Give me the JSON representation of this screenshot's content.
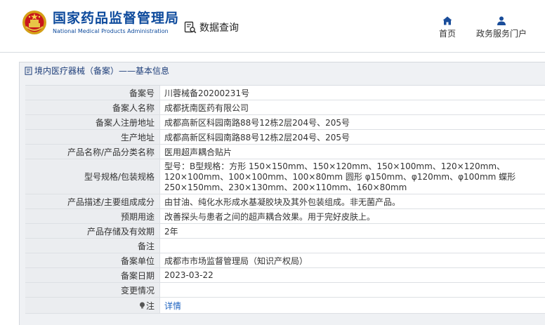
{
  "header": {
    "logo_cn": "国家药品监督管理局",
    "logo_en": "National Medical Products Administration",
    "data_query": "数据查询",
    "nav": [
      {
        "label": "首页",
        "icon": "home-icon"
      },
      {
        "label": "政务服务门户",
        "icon": "user-icon"
      }
    ]
  },
  "panel": {
    "title": "境内医疗器械（备案）——基本信息"
  },
  "rows": [
    {
      "label": "备案号",
      "value": "川蓉械备20200231号"
    },
    {
      "label": "备案人名称",
      "value": "成都抚南医药有限公司"
    },
    {
      "label": "备案人注册地址",
      "value": "成都高新区科园南路88号12栋2层204号、205号"
    },
    {
      "label": "生产地址",
      "value": "成都高新区科园南路88号12栋2层204号、205号"
    },
    {
      "label": "产品名称/产品分类名称",
      "value": "医用超声耦合贴片"
    },
    {
      "label": "型号规格/包装规格",
      "value": "型号：B型规格：方形 150×150mm、150×120mm、150×100mm、120×120mm、120×100mm、100×100mm、100×80mm 圆形 φ150mm、φ120mm、φ100mm 蝶形 250×150mm、230×130mm、200×110mm、160×80mm"
    },
    {
      "label": "产品描述/主要组成成分",
      "value": "由甘油、纯化水形成水基凝胶块及其外包装组成。非无菌产品。"
    },
    {
      "label": "预期用途",
      "value": "改善探头与患者之间的超声耦合效果。用于完好皮肤上。"
    },
    {
      "label": "产品存储及有效期",
      "value": "2年"
    },
    {
      "label": "备注",
      "value": ""
    },
    {
      "label": "备案单位",
      "value": "成都市市场监督管理局（知识产权局）"
    },
    {
      "label": "备案日期",
      "value": "2023-03-22"
    },
    {
      "label": "变更情况",
      "value": ""
    },
    {
      "label": "注",
      "value": "详情",
      "icon": "lightbulb-icon"
    }
  ],
  "colors": {
    "brand": "#0d4a9c",
    "link": "#1e63c0",
    "label_bg": "#ebedf0"
  }
}
